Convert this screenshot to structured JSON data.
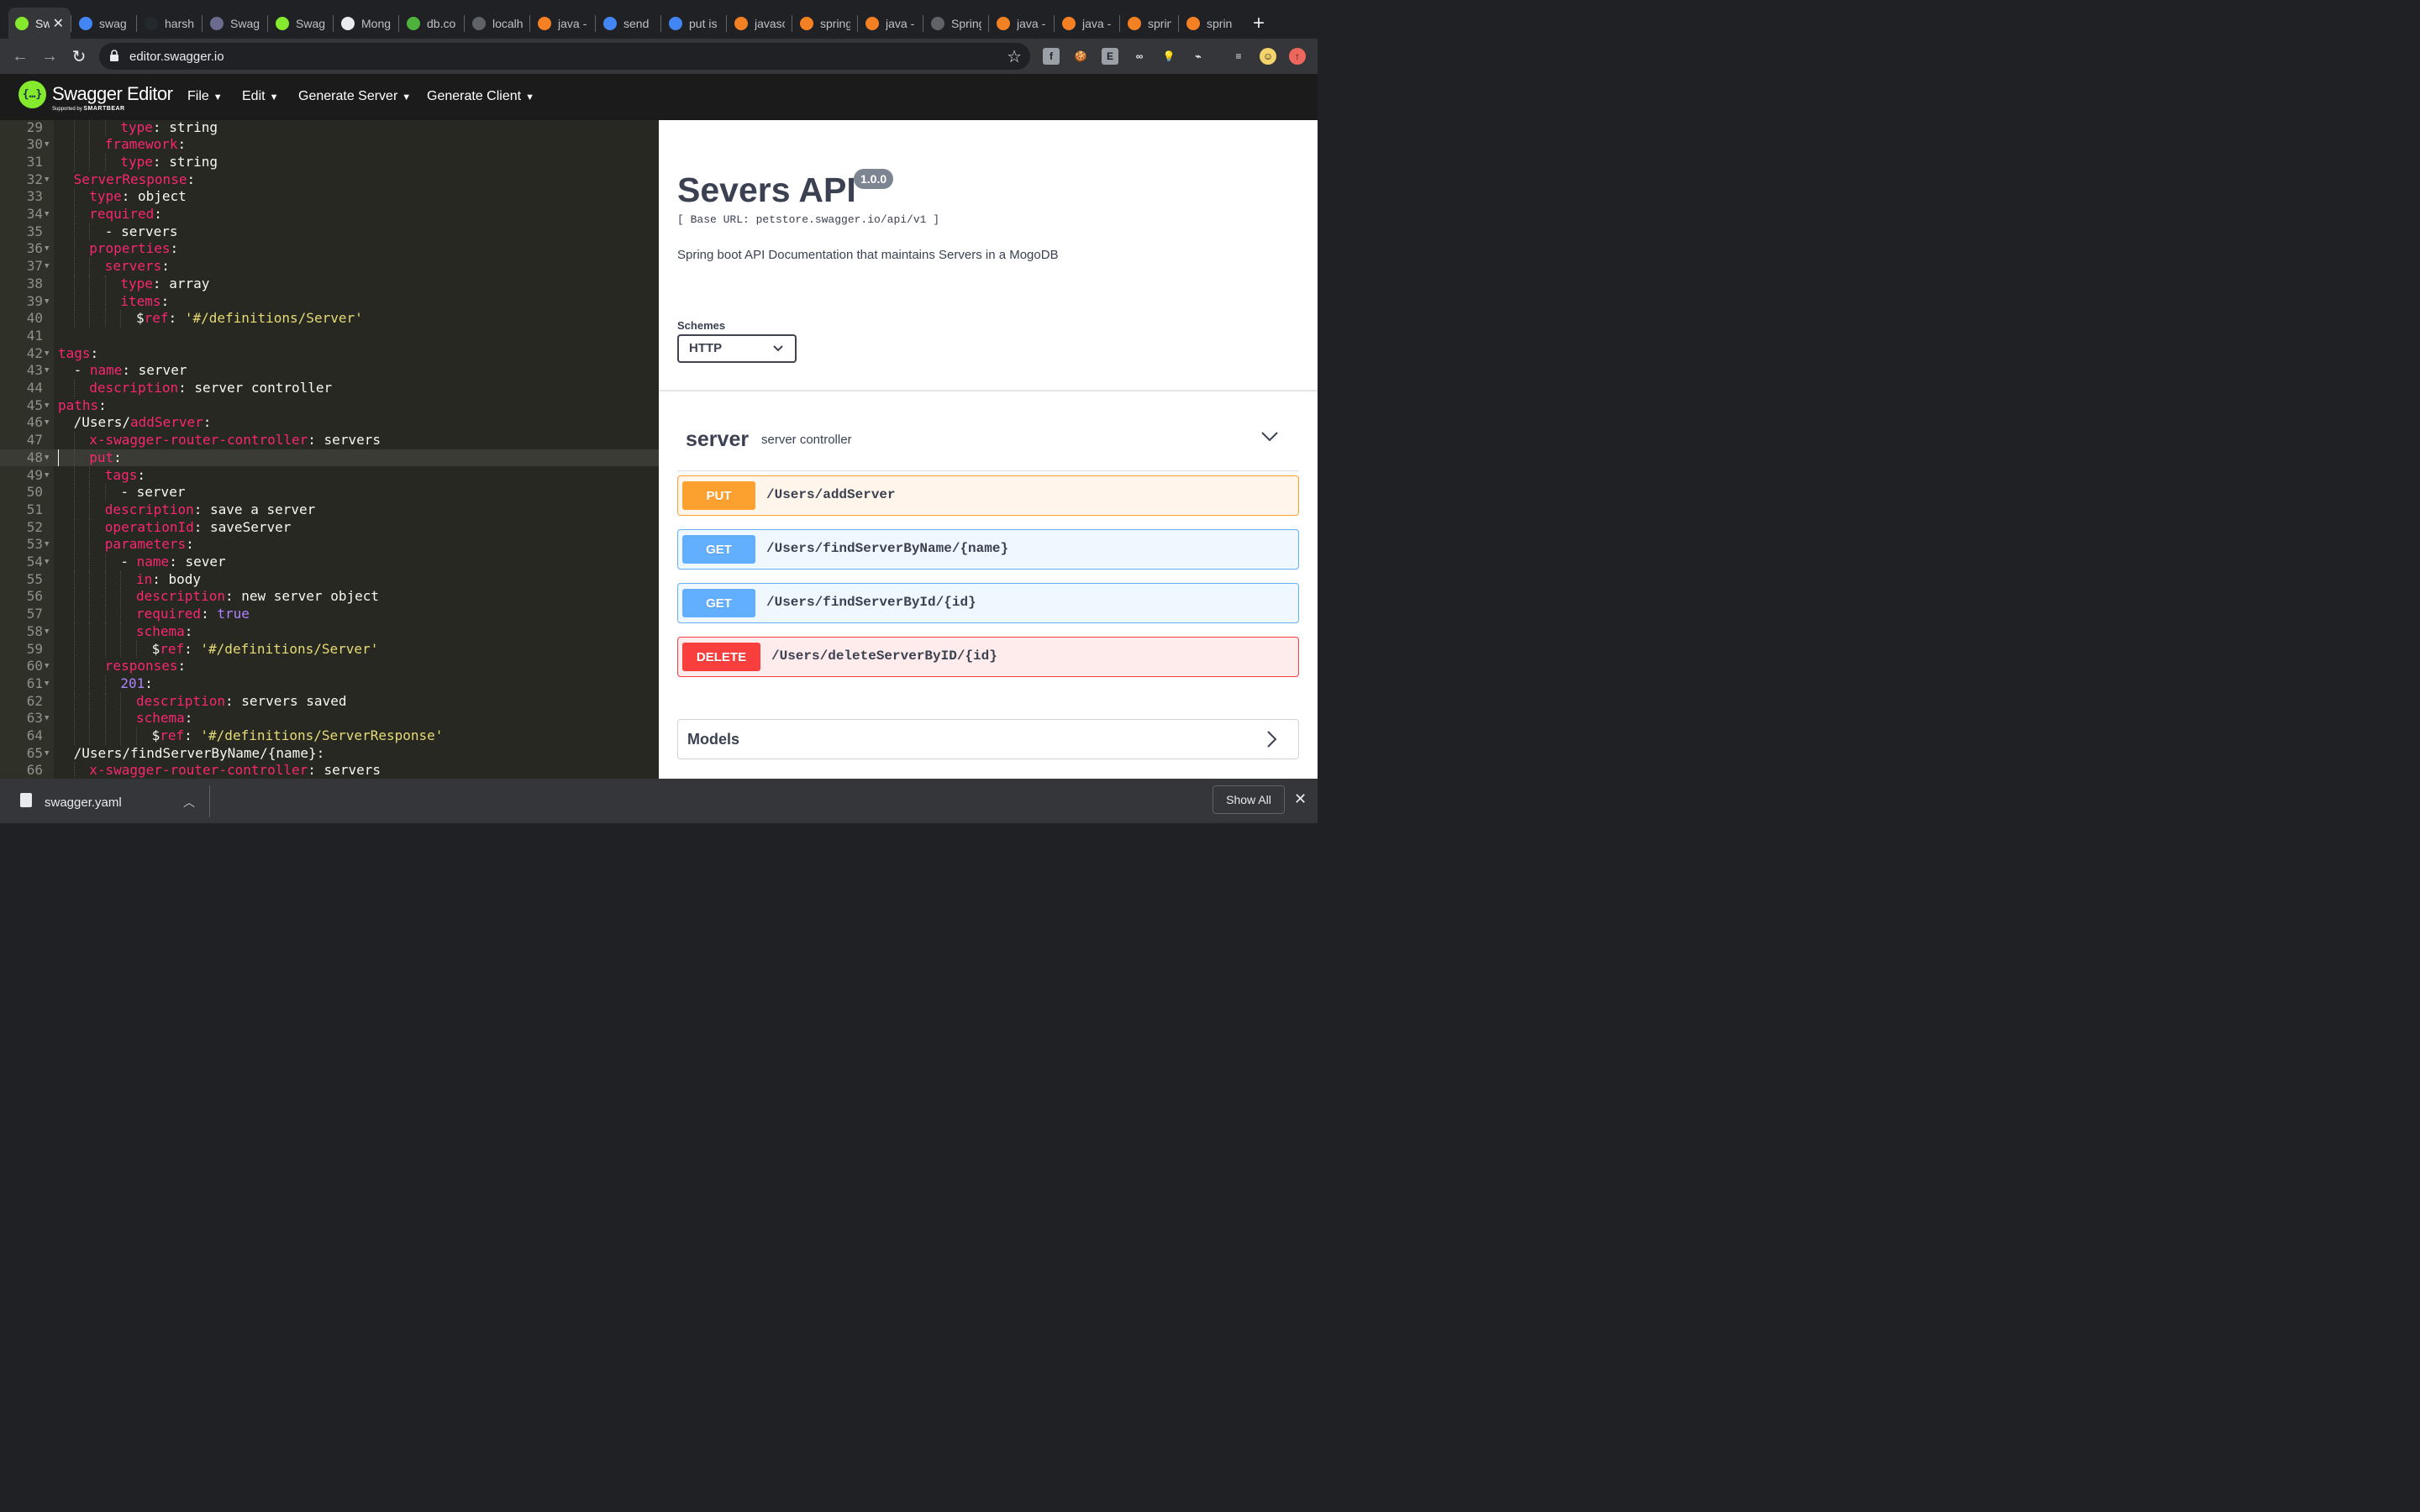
{
  "browser": {
    "tabs": [
      {
        "label": "Sw",
        "icon": "swagger-favicon-icon",
        "color": "#85ea2d",
        "active": true
      },
      {
        "label": "swag",
        "icon": "google-favicon-icon",
        "color": "#4285f4"
      },
      {
        "label": "harsh",
        "icon": "github-favicon-icon",
        "color": "#24292e"
      },
      {
        "label": "Swag",
        "icon": "swagger-hex-favicon-icon",
        "color": "#6b6b8f"
      },
      {
        "label": "Swag",
        "icon": "swagger-favicon-icon",
        "color": "#85ea2d"
      },
      {
        "label": "Mong",
        "icon": "mongoose-favicon-icon",
        "color": "#e8eaed"
      },
      {
        "label": "db.co",
        "icon": "mongodb-leaf-icon",
        "color": "#4db33d"
      },
      {
        "label": "localh",
        "icon": "globe-icon",
        "color": "#5f6368"
      },
      {
        "label": "java -",
        "icon": "stackoverflow-icon",
        "color": "#f48024"
      },
      {
        "label": "send",
        "icon": "google-favicon-icon",
        "color": "#4285f4"
      },
      {
        "label": "put is",
        "icon": "google-favicon-icon",
        "color": "#4285f4"
      },
      {
        "label": "javasc",
        "icon": "stackoverflow-icon",
        "color": "#f48024"
      },
      {
        "label": "spring",
        "icon": "stackoverflow-icon",
        "color": "#f48024"
      },
      {
        "label": "java -",
        "icon": "stackoverflow-icon",
        "color": "#f48024"
      },
      {
        "label": "Spring",
        "icon": "globe-icon",
        "color": "#5f6368"
      },
      {
        "label": "java -",
        "icon": "stackoverflow-icon",
        "color": "#f48024"
      },
      {
        "label": "java -",
        "icon": "stackoverflow-icon",
        "color": "#f48024"
      },
      {
        "label": "spring",
        "icon": "stackoverflow-icon",
        "color": "#f48024"
      },
      {
        "label": "spring",
        "icon": "stackoverflow-icon",
        "color": "#f48024"
      }
    ],
    "url": "editor.swagger.io",
    "extensions": [
      {
        "icon": "facebook-ext-icon",
        "glyph": "f",
        "color": "#9aa0a6"
      },
      {
        "icon": "cookie-ext-icon",
        "glyph": "🍪",
        "color": "#35363a"
      },
      {
        "icon": "e-ext-icon",
        "glyph": "E",
        "color": "#9aa0a6"
      },
      {
        "icon": "infinity-ext-icon",
        "glyph": "∞",
        "color": "#35363a"
      },
      {
        "icon": "bulb-ext-icon",
        "glyph": "💡",
        "color": "#35363a"
      },
      {
        "icon": "wifi-ext-icon",
        "glyph": "⌁",
        "color": "#35363a"
      },
      {
        "icon": "media-queue-icon",
        "glyph": "≡",
        "color": "#35363a"
      },
      {
        "icon": "profile-avatar-icon",
        "glyph": "☺",
        "color": "#f5d36b"
      },
      {
        "icon": "update-arrow-icon",
        "glyph": "↑",
        "color": "#ee675c"
      }
    ]
  },
  "header": {
    "title": "Swagger Editor",
    "subtitle_prefix": "Supported by",
    "subtitle_brand": "SMARTBEAR",
    "menus": [
      "File",
      "Edit",
      "Generate Server",
      "Generate Client"
    ]
  },
  "editor": {
    "current_line": 48,
    "lines": [
      {
        "n": 29,
        "fold": false,
        "indent": 4,
        "parts": [
          [
            "k",
            "type"
          ],
          [
            "v",
            ": string"
          ]
        ]
      },
      {
        "n": 30,
        "fold": true,
        "indent": 3,
        "parts": [
          [
            "k",
            "framework"
          ],
          [
            "v",
            ":"
          ]
        ]
      },
      {
        "n": 31,
        "fold": false,
        "indent": 4,
        "parts": [
          [
            "k",
            "type"
          ],
          [
            "v",
            ": string"
          ]
        ]
      },
      {
        "n": 32,
        "fold": true,
        "indent": 1,
        "parts": [
          [
            "k",
            "ServerResponse"
          ],
          [
            "v",
            ":"
          ]
        ]
      },
      {
        "n": 33,
        "fold": false,
        "indent": 2,
        "parts": [
          [
            "k",
            "type"
          ],
          [
            "v",
            ": object"
          ]
        ]
      },
      {
        "n": 34,
        "fold": true,
        "indent": 2,
        "parts": [
          [
            "k",
            "required"
          ],
          [
            "v",
            ":"
          ]
        ]
      },
      {
        "n": 35,
        "fold": false,
        "indent": 3,
        "parts": [
          [
            "v",
            "- servers"
          ]
        ]
      },
      {
        "n": 36,
        "fold": true,
        "indent": 2,
        "parts": [
          [
            "k",
            "properties"
          ],
          [
            "v",
            ":"
          ]
        ]
      },
      {
        "n": 37,
        "fold": true,
        "indent": 3,
        "parts": [
          [
            "k",
            "servers"
          ],
          [
            "v",
            ":"
          ]
        ]
      },
      {
        "n": 38,
        "fold": false,
        "indent": 4,
        "parts": [
          [
            "k",
            "type"
          ],
          [
            "v",
            ": array"
          ]
        ]
      },
      {
        "n": 39,
        "fold": true,
        "indent": 4,
        "parts": [
          [
            "k",
            "items"
          ],
          [
            "v",
            ":"
          ]
        ]
      },
      {
        "n": 40,
        "fold": false,
        "indent": 5,
        "parts": [
          [
            "v",
            "$"
          ],
          [
            "k",
            "ref"
          ],
          [
            "v",
            ": "
          ],
          [
            "s",
            "'#/definitions/Server'"
          ]
        ]
      },
      {
        "n": 41,
        "fold": false,
        "indent": 0,
        "parts": []
      },
      {
        "n": 42,
        "fold": true,
        "indent": 0,
        "parts": [
          [
            "k",
            "tags"
          ],
          [
            "v",
            ":"
          ]
        ]
      },
      {
        "n": 43,
        "fold": true,
        "indent": 1,
        "parts": [
          [
            "v",
            "- "
          ],
          [
            "k",
            "name"
          ],
          [
            "v",
            ": server"
          ]
        ]
      },
      {
        "n": 44,
        "fold": false,
        "indent": 2,
        "parts": [
          [
            "k",
            "description"
          ],
          [
            "v",
            ": server controller"
          ]
        ]
      },
      {
        "n": 45,
        "fold": true,
        "indent": 0,
        "parts": [
          [
            "k",
            "paths"
          ],
          [
            "v",
            ":"
          ]
        ]
      },
      {
        "n": 46,
        "fold": true,
        "indent": 1,
        "parts": [
          [
            "v",
            "/Users/"
          ],
          [
            "k",
            "addServer"
          ],
          [
            "v",
            ":"
          ]
        ]
      },
      {
        "n": 47,
        "fold": false,
        "indent": 2,
        "parts": [
          [
            "k",
            "x-swagger-router-controller"
          ],
          [
            "v",
            ": servers"
          ]
        ]
      },
      {
        "n": 48,
        "fold": true,
        "indent": 2,
        "parts": [
          [
            "k",
            "put"
          ],
          [
            "v",
            ":"
          ]
        ]
      },
      {
        "n": 49,
        "fold": true,
        "indent": 3,
        "parts": [
          [
            "k",
            "tags"
          ],
          [
            "v",
            ":"
          ]
        ]
      },
      {
        "n": 50,
        "fold": false,
        "indent": 4,
        "parts": [
          [
            "v",
            "- server"
          ]
        ]
      },
      {
        "n": 51,
        "fold": false,
        "indent": 3,
        "parts": [
          [
            "k",
            "description"
          ],
          [
            "v",
            ": save a server"
          ]
        ]
      },
      {
        "n": 52,
        "fold": false,
        "indent": 3,
        "parts": [
          [
            "k",
            "operationId"
          ],
          [
            "v",
            ": saveServer"
          ]
        ]
      },
      {
        "n": 53,
        "fold": true,
        "indent": 3,
        "parts": [
          [
            "k",
            "parameters"
          ],
          [
            "v",
            ":"
          ]
        ]
      },
      {
        "n": 54,
        "fold": true,
        "indent": 4,
        "parts": [
          [
            "v",
            "- "
          ],
          [
            "k",
            "name"
          ],
          [
            "v",
            ": sever"
          ]
        ]
      },
      {
        "n": 55,
        "fold": false,
        "indent": 5,
        "parts": [
          [
            "k",
            "in"
          ],
          [
            "v",
            ": body"
          ]
        ]
      },
      {
        "n": 56,
        "fold": false,
        "indent": 5,
        "parts": [
          [
            "k",
            "description"
          ],
          [
            "v",
            ": new server object"
          ]
        ]
      },
      {
        "n": 57,
        "fold": false,
        "indent": 5,
        "parts": [
          [
            "k",
            "required"
          ],
          [
            "v",
            ": "
          ],
          [
            "b",
            "true"
          ]
        ]
      },
      {
        "n": 58,
        "fold": true,
        "indent": 5,
        "parts": [
          [
            "k",
            "schema"
          ],
          [
            "v",
            ":"
          ]
        ]
      },
      {
        "n": 59,
        "fold": false,
        "indent": 6,
        "parts": [
          [
            "v",
            "$"
          ],
          [
            "k",
            "ref"
          ],
          [
            "v",
            ": "
          ],
          [
            "s",
            "'#/definitions/Server'"
          ]
        ]
      },
      {
        "n": 60,
        "fold": true,
        "indent": 3,
        "parts": [
          [
            "k",
            "responses"
          ],
          [
            "v",
            ":"
          ]
        ]
      },
      {
        "n": 61,
        "fold": true,
        "indent": 4,
        "parts": [
          [
            "b",
            "201"
          ],
          [
            "v",
            ":"
          ]
        ]
      },
      {
        "n": 62,
        "fold": false,
        "indent": 5,
        "parts": [
          [
            "k",
            "description"
          ],
          [
            "v",
            ": servers saved"
          ]
        ]
      },
      {
        "n": 63,
        "fold": true,
        "indent": 5,
        "parts": [
          [
            "k",
            "schema"
          ],
          [
            "v",
            ":"
          ]
        ]
      },
      {
        "n": 64,
        "fold": false,
        "indent": 6,
        "parts": [
          [
            "v",
            "$"
          ],
          [
            "k",
            "ref"
          ],
          [
            "v",
            ": "
          ],
          [
            "s",
            "'#/definitions/ServerResponse'"
          ]
        ]
      },
      {
        "n": 65,
        "fold": true,
        "indent": 1,
        "parts": [
          [
            "v",
            "/Users/findServerByName/{name}:"
          ]
        ]
      },
      {
        "n": 66,
        "fold": false,
        "indent": 2,
        "parts": [
          [
            "k",
            "x-swagger-router-controller"
          ],
          [
            "v",
            ": servers"
          ]
        ]
      }
    ]
  },
  "preview": {
    "title": "Severs API",
    "version": "1.0.0",
    "base_url": "[ Base URL: petstore.swagger.io/api/v1 ]",
    "description": "Spring boot API Documentation that maintains Servers in a MogoDB",
    "schemes_label": "Schemes",
    "schemes_value": "HTTP",
    "tag": {
      "name": "server",
      "description": "server controller"
    },
    "operations": [
      {
        "method": "PUT",
        "path": "/Users/addServer",
        "color": "#fca130",
        "bg": "#fff5ea"
      },
      {
        "method": "GET",
        "path": "/Users/findServerByName/{name}",
        "color": "#61affe",
        "bg": "#eff7ff"
      },
      {
        "method": "GET",
        "path": "/Users/findServerById/{id}",
        "color": "#61affe",
        "bg": "#eff7ff"
      },
      {
        "method": "DELETE",
        "path": "/Users/deleteServerByID/{id}",
        "color": "#f93e3e",
        "bg": "#feebeb"
      }
    ],
    "models_label": "Models"
  },
  "downloads": {
    "file_name": "swagger.yaml",
    "show_all_label": "Show All"
  }
}
